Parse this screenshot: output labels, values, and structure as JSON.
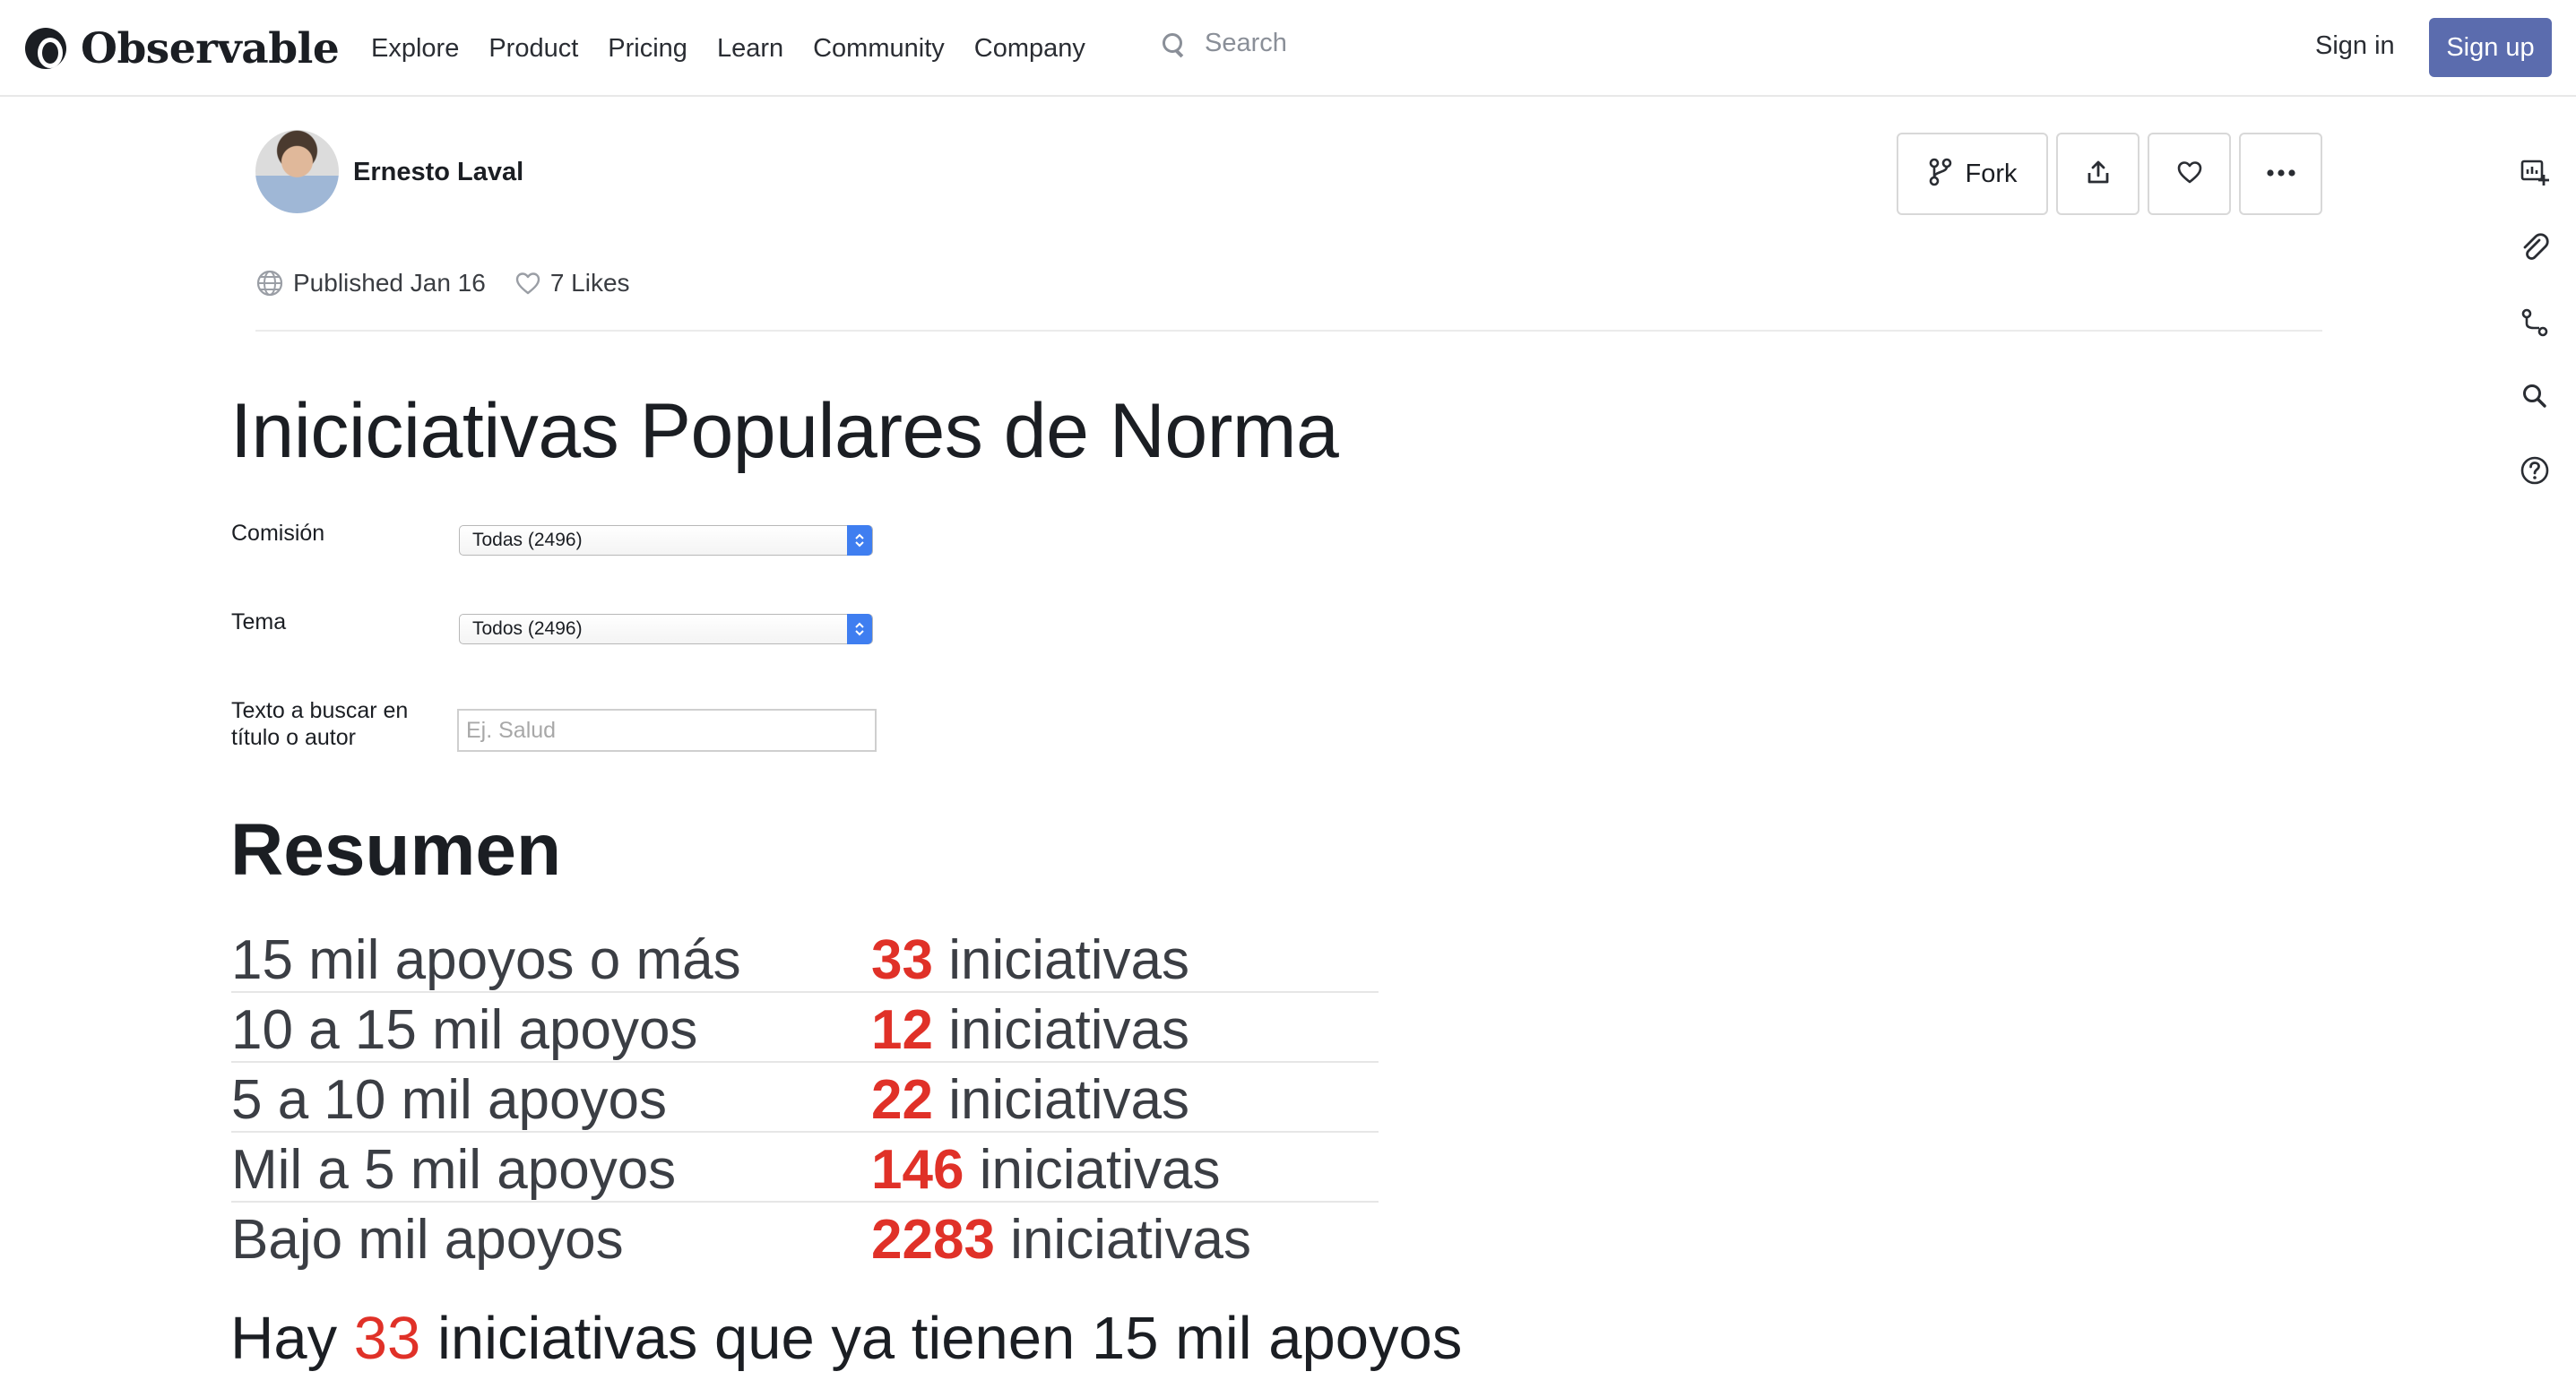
{
  "nav": {
    "logo": "Observable",
    "links": [
      "Explore",
      "Product",
      "Pricing",
      "Learn",
      "Community",
      "Company"
    ],
    "search_placeholder": "Search",
    "sign_in": "Sign in",
    "sign_up": "Sign up",
    "accent_color": "#5b6cae"
  },
  "author": {
    "name": "Ernesto Laval",
    "published": "Published Jan 16",
    "likes": "7 Likes"
  },
  "actions": {
    "fork": "Fork"
  },
  "notebook": {
    "title": "Iniciciativas Populares de Norma",
    "filters": {
      "comision_label": "Comisión",
      "comision_value": "Todas (2496)",
      "tema_label": "Tema",
      "tema_value": "Todos (2496)",
      "search_label_line1": "Texto a buscar en",
      "search_label_line2": "título o autor",
      "search_placeholder": "Ej. Salud"
    },
    "summary_heading": "Resumen",
    "summary": [
      {
        "label": "15 mil apoyos o más",
        "count": "33",
        "unit": "iniciativas"
      },
      {
        "label": "10 a 15 mil apoyos",
        "count": "12",
        "unit": "iniciativas"
      },
      {
        "label": "5 a 10 mil apoyos",
        "count": "22",
        "unit": "iniciativas"
      },
      {
        "label": "Mil a 5 mil apoyos",
        "count": "146",
        "unit": "iniciativas"
      },
      {
        "label": "Bajo mil apoyos",
        "count": "2283",
        "unit": "iniciativas"
      }
    ],
    "headline": {
      "prefix": "Hay",
      "count": "33",
      "suffix": "iniciativas que ya tienen 15 mil apoyos"
    },
    "highlight_color": "#e03128"
  }
}
